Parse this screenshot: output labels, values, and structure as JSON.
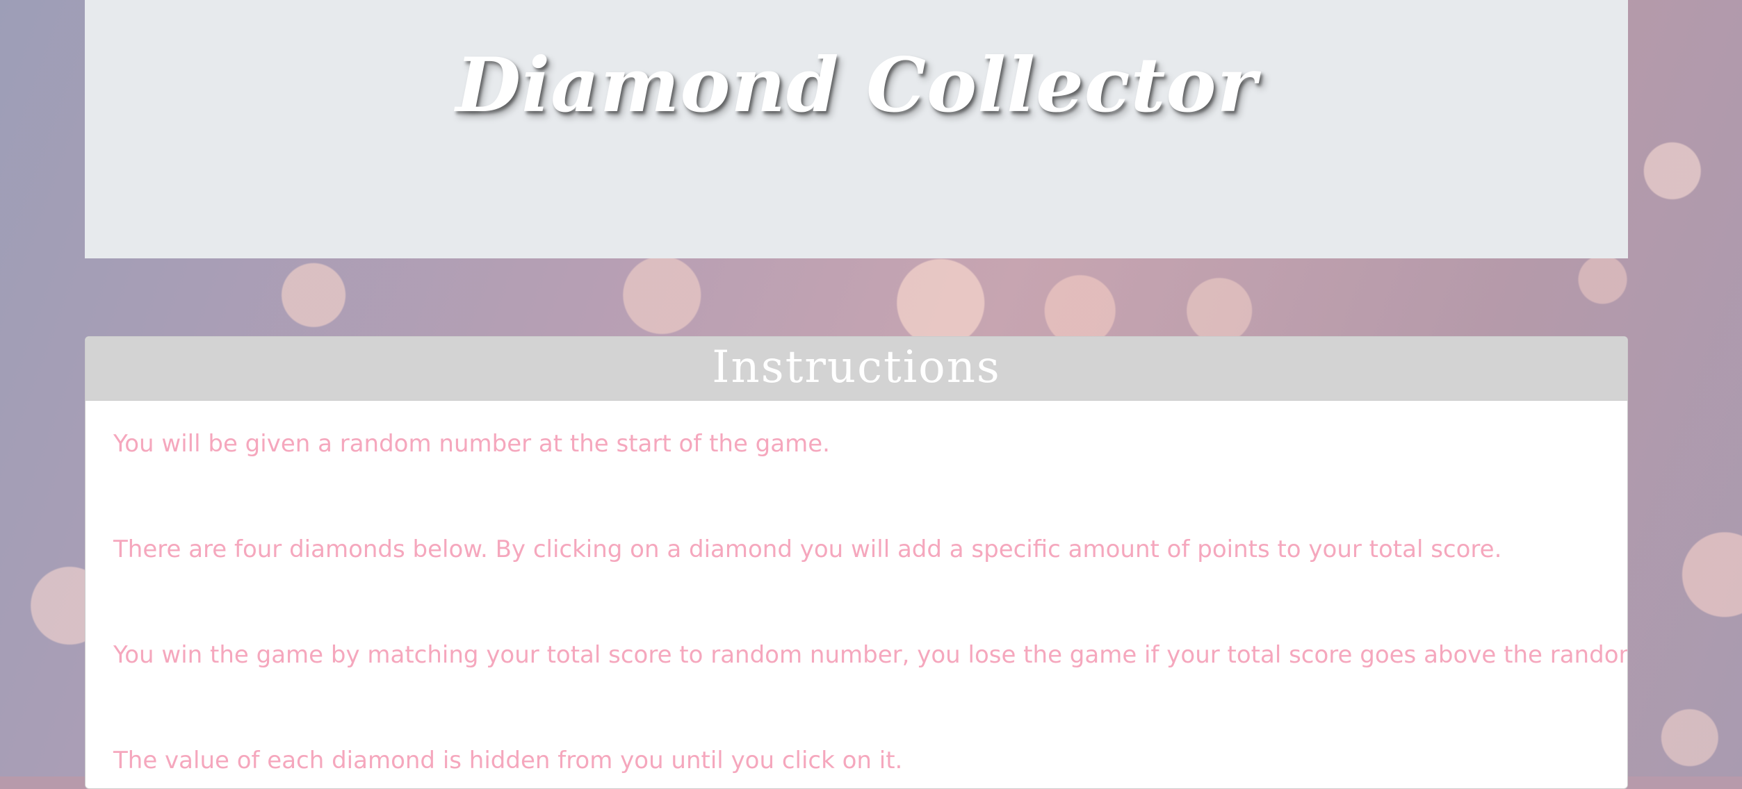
{
  "header": {
    "title": "Diamond Collector"
  },
  "instructions": {
    "title": "Instructions",
    "items": [
      "You will be given a random number at the start of the game.",
      "There are four diamonds below. By clicking on a diamond you will add a specific amount of points to your total score.",
      "You win the game by matching your total score to random number, you lose the game if your total score goes above the random number.",
      "The value of each diamond is hidden from you until you click on it."
    ]
  },
  "colors": {
    "header_background": "#e7eaed",
    "title_text": "#ffffff",
    "card_header_background": "#d3d3d3",
    "instruction_text": "#f5a7bd",
    "card_background": "#ffffff"
  }
}
